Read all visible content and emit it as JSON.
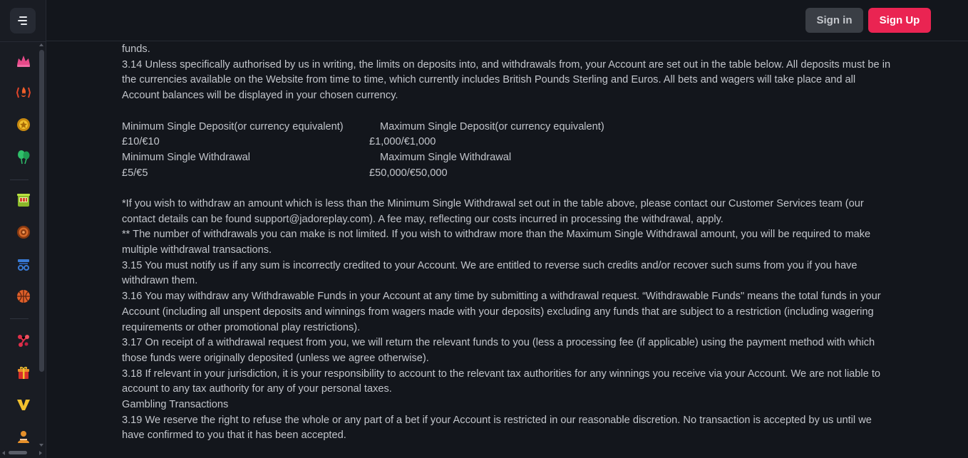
{
  "header": {
    "signin_label": "Sign in",
    "signup_label": "Sign Up"
  },
  "sidebar": {
    "items": [
      {
        "icon": "fire-crown-icon",
        "color": "#e84a8a"
      },
      {
        "icon": "flame-brackets-icon",
        "color": "#e0452a"
      },
      {
        "icon": "star-badge-icon",
        "color": "#e6a817"
      },
      {
        "icon": "balloons-icon",
        "color": "#2fbf6a"
      },
      {
        "icon": "slot-machine-icon",
        "color": "#9ccc2e"
      },
      {
        "icon": "target-icon",
        "color": "#d66a2a"
      },
      {
        "icon": "table-games-icon",
        "color": "#3a7bd5"
      },
      {
        "icon": "basketball-icon",
        "color": "#e0602a"
      },
      {
        "icon": "molecule-icon",
        "color": "#e0304a"
      },
      {
        "icon": "gift-icon",
        "color": "#e68a2a"
      },
      {
        "icon": "v-logo-icon",
        "color": "#f2c12e"
      },
      {
        "icon": "users-icon",
        "color": "#e6902a"
      }
    ]
  },
  "content": {
    "line_funds": "funds.",
    "p_3_14": "3.14 Unless specifically authorised by us in writing, the limits on deposits into, and withdrawals from, your Account are set out in the table below. All deposits must be in the currencies available on the Website from time to time, which currently includes British Pounds Sterling and Euros. All bets and wagers will take place and all Account balances will be displayed in your chosen currency.",
    "table": {
      "min_deposit_label": "Minimum Single Deposit(or currency equivalent)",
      "max_deposit_label": "Maximum Single Deposit(or currency equivalent)",
      "min_deposit_value": "£10/€10",
      "max_deposit_value": "£1,000/€1,000",
      "min_withdrawal_label": "Minimum Single Withdrawal",
      "max_withdrawal_label": "Maximum Single Withdrawal",
      "min_withdrawal_value": "£5/€5",
      "max_withdrawal_value": "£50,000/€50,000"
    },
    "note_1": "*If you wish to withdraw an amount which is less than the Minimum Single Withdrawal set out in the table above, please contact our Customer Services team (our contact details can be found support@jadoreplay.com). A fee may, reflecting our costs incurred in processing the withdrawal, apply.",
    "note_2": "** The number of withdrawals you can make is not limited. If you wish to withdraw more than the Maximum Single Withdrawal amount, you will be required to make multiple withdrawal transactions.",
    "p_3_15": "3.15 You must notify us if any sum is incorrectly credited to your Account. We are entitled to reverse such credits and/or recover such sums from you if you have withdrawn them.",
    "p_3_16": "3.16 You may withdraw any Withdrawable Funds in your Account at any time by submitting a withdrawal request. “Withdrawable Funds\" means the total funds in your Account (including all unspent deposits and winnings from wagers made with your deposits) excluding any funds that are subject to a restriction (including wagering requirements or other promotional play restrictions).",
    "p_3_17": "3.17 On receipt of a withdrawal request from you, we will return the relevant funds to you (less a processing fee (if applicable) using the payment method with which those funds were originally deposited (unless we agree otherwise).",
    "p_3_18": "3.18 If relevant in your jurisdiction, it is your responsibility to account to the relevant tax authorities for any winnings you receive via your Account. We are not liable to account to any tax authority for any of your personal taxes.",
    "heading_gambling": "Gambling Transactions",
    "p_3_19": "3.19 We reserve the right to refuse the whole or any part of a bet if your Account is restricted in our reasonable discretion. No transaction is accepted by us until we have confirmed to you that it has been accepted."
  }
}
